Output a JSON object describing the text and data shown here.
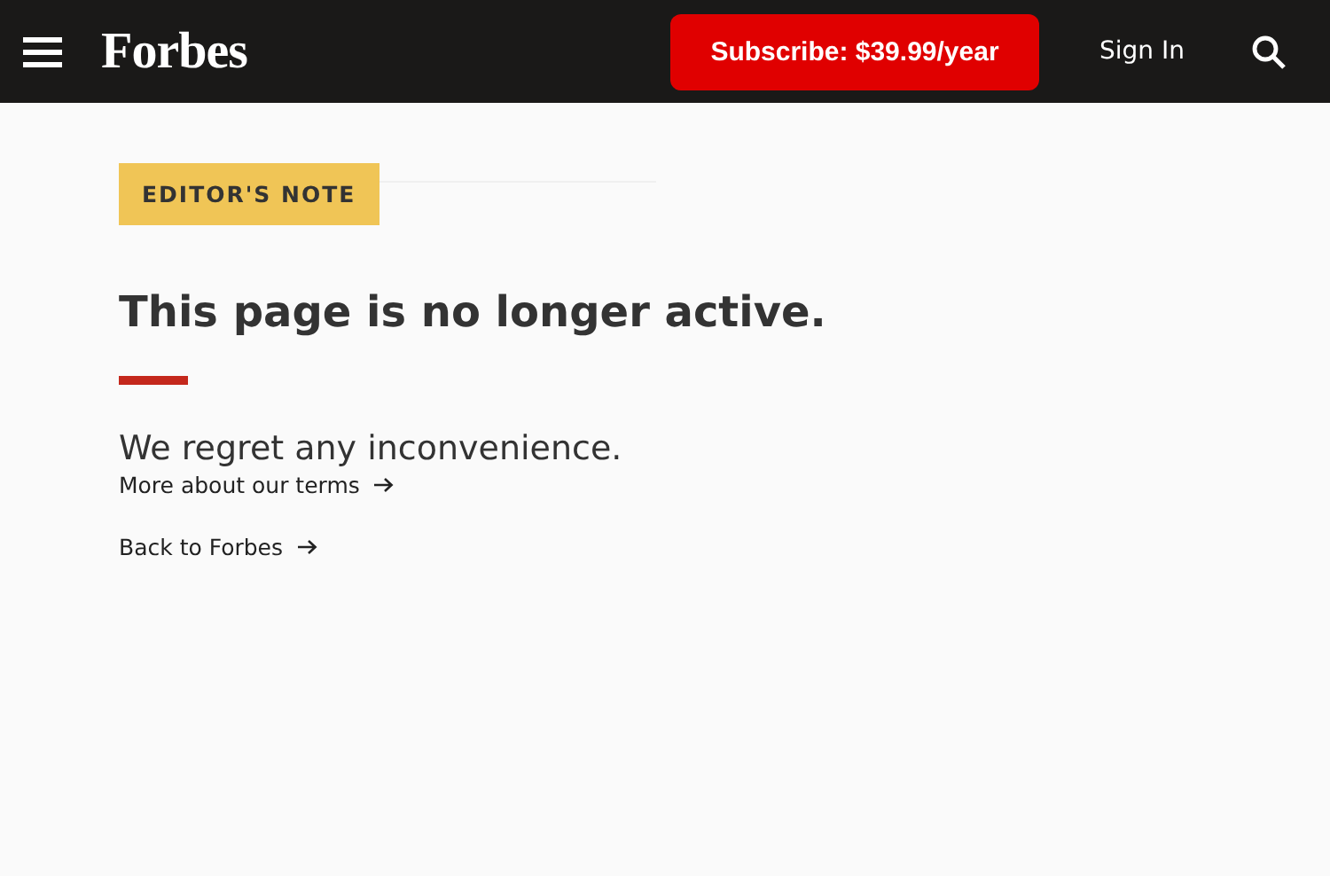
{
  "header": {
    "logo": "Forbes",
    "subscribe_button": "Subscribe: $39.99/year",
    "sign_in": "Sign In"
  },
  "notice": {
    "badge": "EDITOR'S NOTE",
    "title": "This page is no longer active.",
    "message": "We regret any inconvenience.",
    "links": [
      {
        "label": "More about our terms"
      },
      {
        "label": "Back to Forbes"
      }
    ]
  }
}
